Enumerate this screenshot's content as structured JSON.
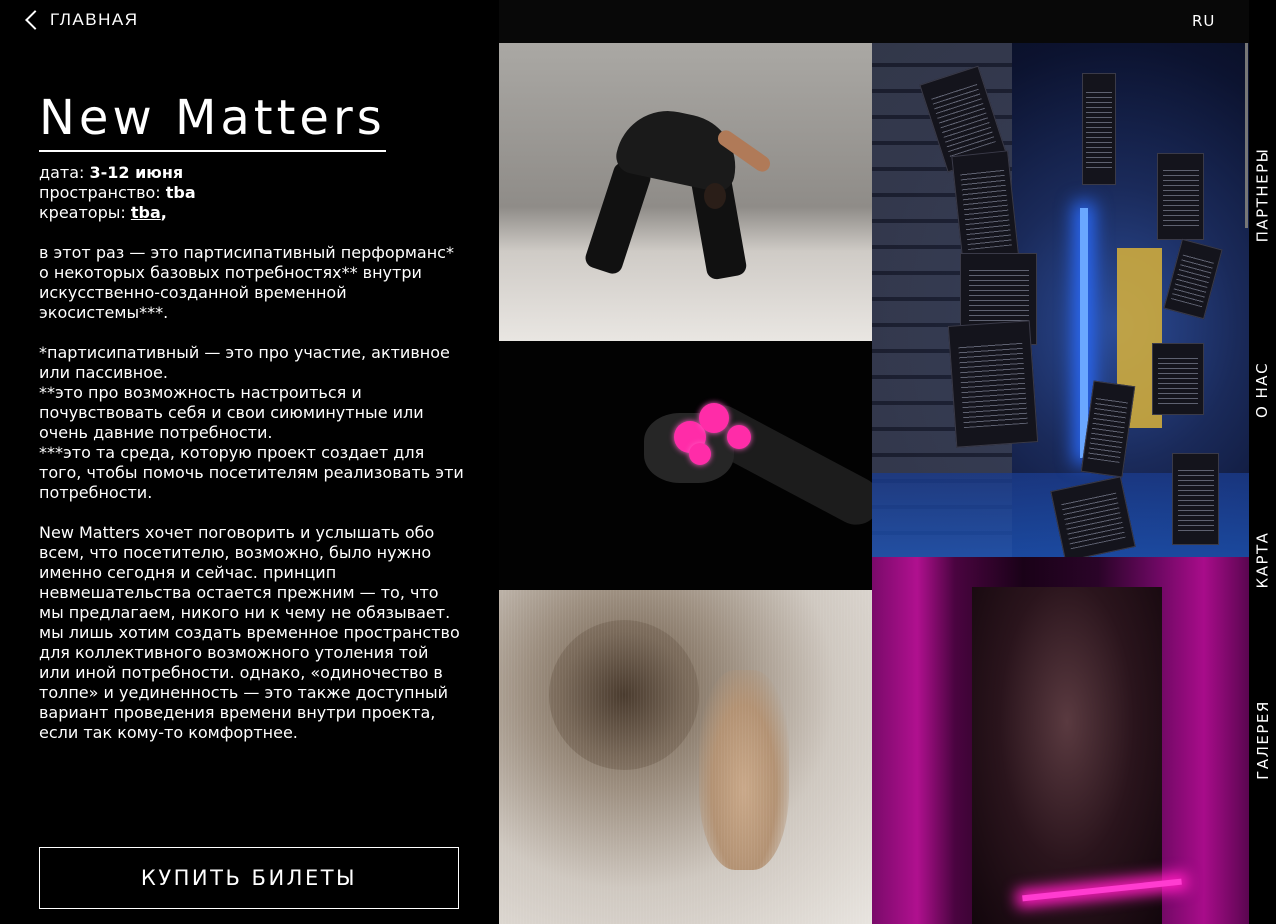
{
  "nav": {
    "back_label": "ГЛАВНАЯ",
    "lang": "RU",
    "side_items": [
      {
        "label": "ПАРТНЕРЫ"
      },
      {
        "label": "О НАС"
      },
      {
        "label": "КАРТА"
      },
      {
        "label": "ГАЛЕРЕЯ"
      }
    ]
  },
  "event": {
    "title": "New Matters",
    "date_label": "дата:",
    "date_value": "3-12 июня",
    "space_label": "пространство:",
    "space_value": "tba",
    "creators_label": "креаторы:",
    "creators_value": "tba",
    "creators_suffix": ","
  },
  "description": {
    "p1": "в этот раз — это партисипативный перформанс* о некоторых базовых потребностях** внутри искусственно-созданной временной экосистемы***.",
    "p2_l1": "*партисипативный — это про участие, активное или пассивное.",
    "p2_l2": "**это про возможность настроиться и почувствовать себя и свои сиюминутные или очень давние потребности.",
    "p2_l3": "***это та среда, которую проект создает для того, чтобы помочь посетителям реализовать эти потребности.",
    "p3": "New Matters хочет поговорить и услышать обо всем, что посетителю, возможно, было нужно именно сегодня и сейчас. принцип невмешательства остается прежним — то, что мы предлагаем, никого ни к чему не обязывает. мы лишь хотим создать временное пространство для коллективного возможного утоления той или иной потребности. однако, «одиночество в толпе» и уединенность — это также доступный вариант проведения времени внутри проекта, если так кому-то комфортнее."
  },
  "cta": {
    "buy_label": "КУПИТЬ БИЛЕТЫ"
  },
  "gallery": {
    "accent_pink": "#ff2ca8",
    "accent_blue": "#2b6cff",
    "accent_magenta": "#b0108f"
  }
}
